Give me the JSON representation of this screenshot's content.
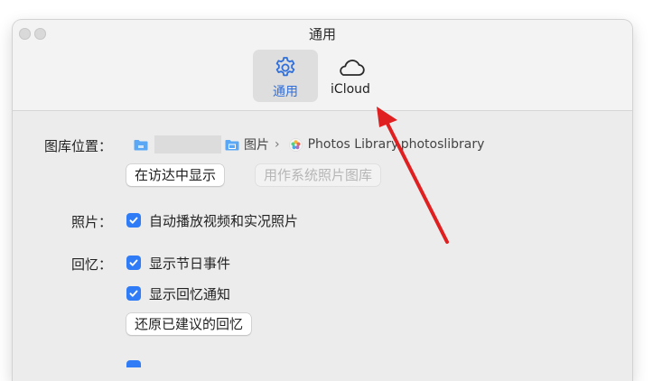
{
  "window": {
    "title": "通用"
  },
  "tabs": [
    {
      "label": "通用",
      "icon": "gear-icon",
      "selected": true
    },
    {
      "label": "iCloud",
      "icon": "cloud-icon",
      "selected": false
    }
  ],
  "library": {
    "label": "图库位置：",
    "path_folder": "图片",
    "path_library": "Photos Library.photoslibrary",
    "show_in_finder": "在访达中显示",
    "use_as_system_library": "用作系统照片图库"
  },
  "photos": {
    "label": "照片：",
    "autoplay": "自动播放视频和实况照片"
  },
  "memories": {
    "label": "回忆：",
    "show_holidays": "显示节日事件",
    "show_notifications": "显示回忆通知",
    "reset_suggested": "还原已建议的回忆"
  },
  "colors": {
    "accent": "#2f7cf6",
    "annotation_arrow": "#e02020"
  }
}
